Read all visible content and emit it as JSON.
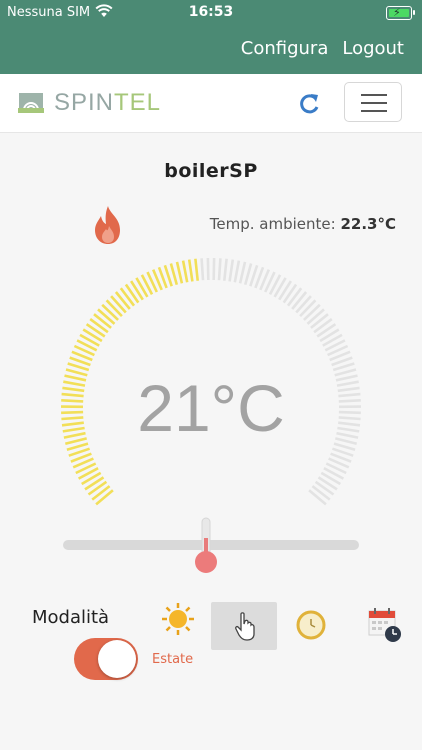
{
  "status_bar": {
    "carrier": "Nessuna SIM",
    "time": "16:53"
  },
  "header": {
    "configura": "Configura",
    "logout": "Logout"
  },
  "navbar": {
    "brand_spin": "SPIN",
    "brand_tel": "TEL"
  },
  "device": {
    "name": "boilerSP"
  },
  "ambient": {
    "label": "Temp. ambiente:",
    "value": "22.3°C"
  },
  "thermostat": {
    "setpoint": "21°C",
    "dial_fill_fraction": 0.48
  },
  "mode": {
    "label": "Modalità",
    "toggle_text": "Estate",
    "toggle_on": true,
    "icons": [
      "sun-icon",
      "hand-pointer-icon",
      "clock-icon",
      "calendar-clock-icon"
    ],
    "selected": "hand-pointer-icon"
  },
  "colors": {
    "topbar": "#4b8a74",
    "accent": "#e1694b",
    "dial_active": "#f2df58",
    "dial_inactive": "#e3e3e3"
  }
}
